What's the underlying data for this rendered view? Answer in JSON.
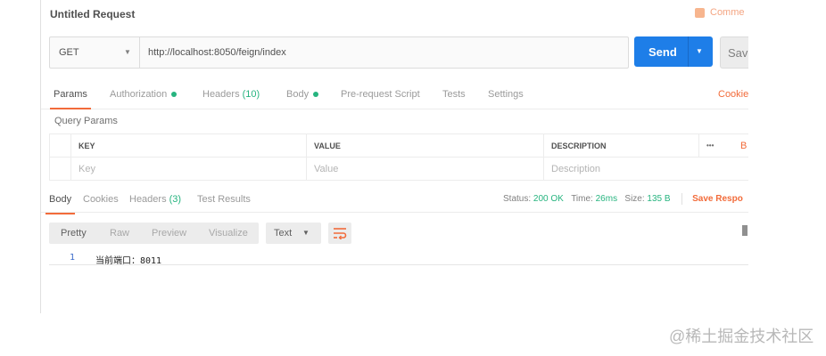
{
  "header": {
    "title": "Untitled Request",
    "comments_label": "Comme"
  },
  "request": {
    "method": "GET",
    "url": "http://localhost:8050/feign/index",
    "send_label": "Send",
    "save_label": "Save"
  },
  "request_tabs": {
    "params": "Params",
    "authorization": "Authorization",
    "headers": "Headers",
    "headers_count": "(10)",
    "body": "Body",
    "pre_request": "Pre-request Script",
    "tests": "Tests",
    "settings": "Settings",
    "cookies": "Cookie"
  },
  "query_params": {
    "title": "Query Params",
    "columns": {
      "key": "KEY",
      "value": "VALUE",
      "description": "DESCRIPTION",
      "more": "•••",
      "bulk": "B"
    },
    "placeholders": {
      "key": "Key",
      "value": "Value",
      "description": "Description"
    }
  },
  "response_tabs": {
    "body": "Body",
    "cookies": "Cookies",
    "headers": "Headers",
    "headers_count": "(3)",
    "test_results": "Test Results"
  },
  "response_status": {
    "status_label": "Status:",
    "status_value": "200 OK",
    "time_label": "Time:",
    "time_value": "26ms",
    "size_label": "Size:",
    "size_value": "135 B",
    "save_response": "Save Respo"
  },
  "response_format": {
    "pretty": "Pretty",
    "raw": "Raw",
    "preview": "Preview",
    "visualize": "Visualize",
    "type": "Text"
  },
  "response_body": {
    "line_number": "1",
    "content": "当前端口：8011"
  },
  "watermark": "@稀土掘金技术社区",
  "colors": {
    "accent": "#f26b3a",
    "send": "#1e7ee8",
    "status_ok": "#26b47f"
  }
}
